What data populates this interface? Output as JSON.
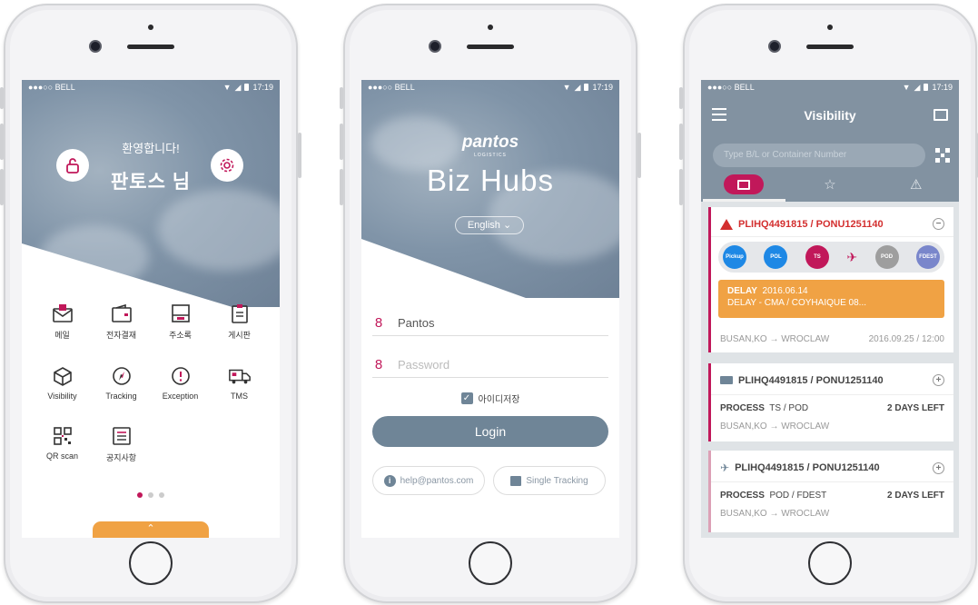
{
  "status": {
    "carrier": "●●●○○ BELL",
    "time": "17:19"
  },
  "phone1": {
    "welcome": "환영합니다!",
    "username": "판토스 님",
    "menu": [
      {
        "label": "메일",
        "icon": "mail-icon"
      },
      {
        "label": "전자결재",
        "icon": "wallet-icon"
      },
      {
        "label": "주소록",
        "icon": "address-book-icon"
      },
      {
        "label": "게시판",
        "icon": "clipboard-icon"
      },
      {
        "label": "Visibility",
        "icon": "box-icon"
      },
      {
        "label": "Tracking",
        "icon": "compass-icon"
      },
      {
        "label": "Exception",
        "icon": "alert-circle-icon"
      },
      {
        "label": "TMS",
        "icon": "truck-icon"
      },
      {
        "label": "QR scan",
        "icon": "qr-code-icon"
      },
      {
        "label": "공지사항",
        "icon": "notice-icon"
      }
    ],
    "pull_tab": "⌃"
  },
  "phone2": {
    "brand": "pantos",
    "brand_sub": "LOGISTICS",
    "app_title": "Biz Hubs",
    "language": "English",
    "username_value": "Pantos",
    "password_placeholder": "Password",
    "remember_label": "아이디저장",
    "login_label": "Login",
    "help_label": "help@pantos.com",
    "single_tracking_label": "Single Tracking"
  },
  "phone3": {
    "title": "Visibility",
    "search_placeholder": "Type B/L or Container Number",
    "cards": [
      {
        "title": "PLIHQ4491815 / PONU1251140",
        "steps": [
          "Pickup",
          "POL",
          "TS",
          "POD",
          "FDEST"
        ],
        "delay_label": "DELAY",
        "delay_date": "2016.06.14",
        "delay_detail": "DELAY - CMA / COYHAIQUE 08...",
        "route": "BUSAN,KO → WROCLAW",
        "route_date": "2016.09.25 / 12:00"
      },
      {
        "title": "PLIHQ4491815 / PONU1251140",
        "process_label": "PROCESS",
        "process_value": "TS / POD",
        "days_left": "2 DAYS LEFT",
        "route": "BUSAN,KO → WROCLAW"
      },
      {
        "title": "PLIHQ4491815 / PONU1251140",
        "process_label": "PROCESS",
        "process_value": "POD / FDEST",
        "days_left": "2 DAYS LEFT",
        "route": "BUSAN,KO → WROCLAW"
      }
    ]
  },
  "colors": {
    "accent": "#c1185a",
    "orange": "#f0a244",
    "slate": "#6f8597",
    "blue": "#1e88e5",
    "grey": "#9e9e9e"
  }
}
